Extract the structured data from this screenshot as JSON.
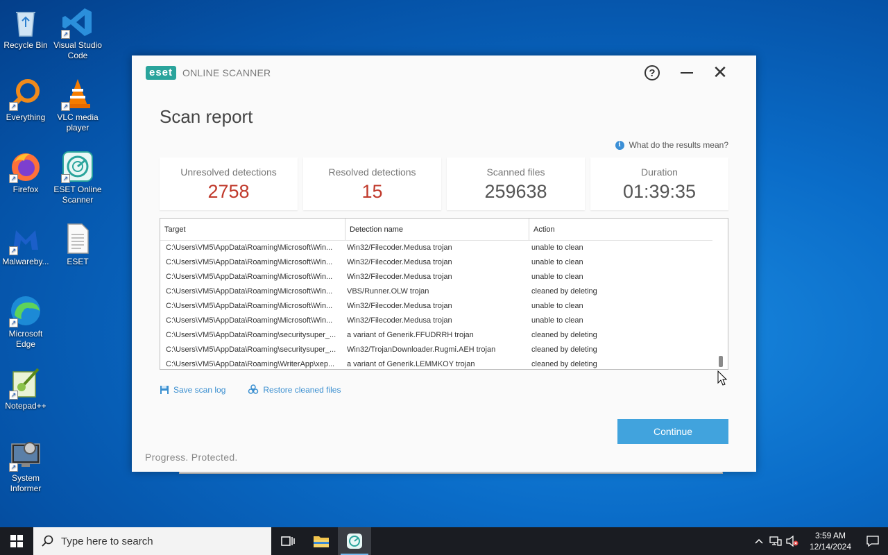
{
  "desktop": {
    "icons": [
      {
        "label": "Recycle Bin"
      },
      {
        "label": "Visual Studio Code"
      },
      {
        "label": "Everything"
      },
      {
        "label": "VLC media player"
      },
      {
        "label": "Firefox"
      },
      {
        "label": "ESET Online Scanner"
      },
      {
        "label": "Malwareby..."
      },
      {
        "label": "ESET"
      },
      {
        "label": "Microsoft Edge"
      },
      {
        "label": "Notepad++"
      },
      {
        "label": "System Informer"
      }
    ]
  },
  "window": {
    "logo_badge": "eset",
    "logo_text": "ONLINE SCANNER",
    "help_glyph": "?",
    "close_glyph": "✕",
    "title": "Scan report",
    "help_link": "What do the results mean?",
    "info_glyph": "i",
    "stats": {
      "unresolved": {
        "label": "Unresolved detections",
        "value": "2758"
      },
      "resolved": {
        "label": "Resolved detections",
        "value": "15"
      },
      "scanned": {
        "label": "Scanned files",
        "value": "259638"
      },
      "duration": {
        "label": "Duration",
        "value": "01:39:35"
      }
    },
    "table": {
      "headers": {
        "target": "Target",
        "detection": "Detection name",
        "action": "Action"
      },
      "rows": [
        {
          "target": "C:\\Users\\VM5\\AppData\\Roaming\\Microsoft\\Win...",
          "detection": "Win32/Filecoder.Medusa trojan",
          "action": "unable to clean"
        },
        {
          "target": "C:\\Users\\VM5\\AppData\\Roaming\\Microsoft\\Win...",
          "detection": "Win32/Filecoder.Medusa trojan",
          "action": "unable to clean"
        },
        {
          "target": "C:\\Users\\VM5\\AppData\\Roaming\\Microsoft\\Win...",
          "detection": "Win32/Filecoder.Medusa trojan",
          "action": "unable to clean"
        },
        {
          "target": "C:\\Users\\VM5\\AppData\\Roaming\\Microsoft\\Win...",
          "detection": "VBS/Runner.OLW trojan",
          "action": "cleaned by deleting"
        },
        {
          "target": "C:\\Users\\VM5\\AppData\\Roaming\\Microsoft\\Win...",
          "detection": "Win32/Filecoder.Medusa trojan",
          "action": "unable to clean"
        },
        {
          "target": "C:\\Users\\VM5\\AppData\\Roaming\\Microsoft\\Win...",
          "detection": "Win32/Filecoder.Medusa trojan",
          "action": "unable to clean"
        },
        {
          "target": "C:\\Users\\VM5\\AppData\\Roaming\\securitysuper_...",
          "detection": "a variant of Generik.FFUDRRH trojan",
          "action": "cleaned by deleting"
        },
        {
          "target": "C:\\Users\\VM5\\AppData\\Roaming\\securitysuper_...",
          "detection": "Win32/TrojanDownloader.Rugmi.AEH trojan",
          "action": "cleaned by deleting"
        },
        {
          "target": "C:\\Users\\VM5\\AppData\\Roaming\\WriterApp\\xep...",
          "detection": "a variant of Generik.LEMMKOY trojan",
          "action": "cleaned by deleting"
        }
      ]
    },
    "save_log": "Save scan log",
    "restore_files": "Restore cleaned files",
    "continue": "Continue",
    "footer": "Progress. Protected."
  },
  "taskbar": {
    "search_placeholder": "Type here to search",
    "time": "3:59 AM",
    "date": "12/14/2024"
  },
  "colors": {
    "accent": "#41a3dd",
    "brand": "#2aa49c",
    "alert": "#c0392b"
  }
}
